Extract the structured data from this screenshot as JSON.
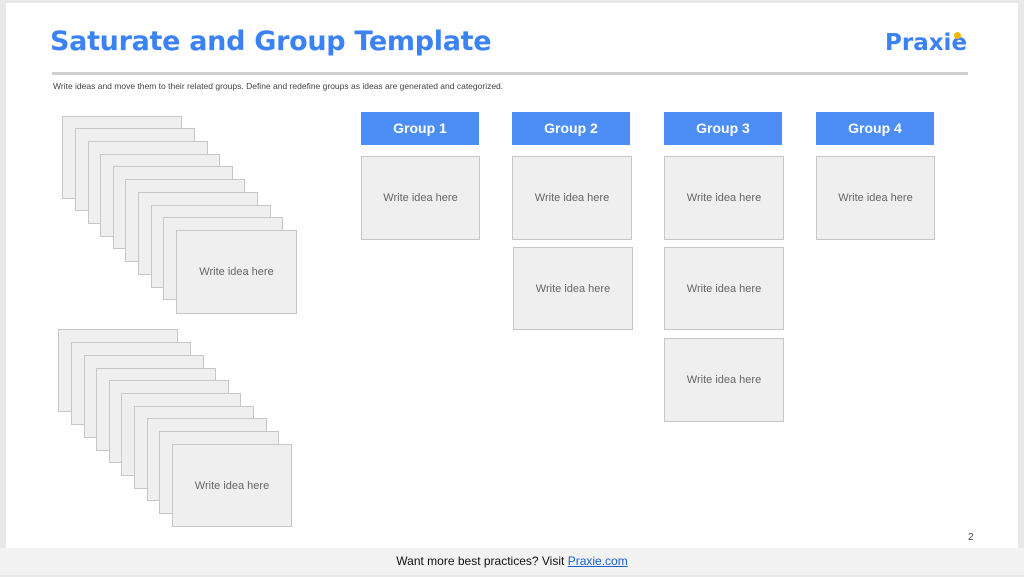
{
  "title": "Saturate and Group Template",
  "logo": "Praxie",
  "subtitle": "Write ideas and move them to their related groups. Define and redefine groups as ideas are generated and categorized.",
  "placeholder": "Write idea here",
  "groups": [
    {
      "label": "Group 1",
      "ideas": [
        "Write idea here"
      ]
    },
    {
      "label": "Group 2",
      "ideas": [
        "Write idea here",
        "Write idea here"
      ]
    },
    {
      "label": "Group 3",
      "ideas": [
        "Write idea here",
        "Write idea here",
        "Write idea here"
      ]
    },
    {
      "label": "Group 4",
      "ideas": [
        "Write idea here"
      ]
    }
  ],
  "page_number": "2",
  "footer": {
    "text": "Want more best practices? Visit ",
    "link": "Praxie.com"
  },
  "colors": {
    "accent": "#3b82f6",
    "header_fill": "#4c8df6",
    "card_fill": "#efefef",
    "logo_dot": "#f6b40e"
  }
}
